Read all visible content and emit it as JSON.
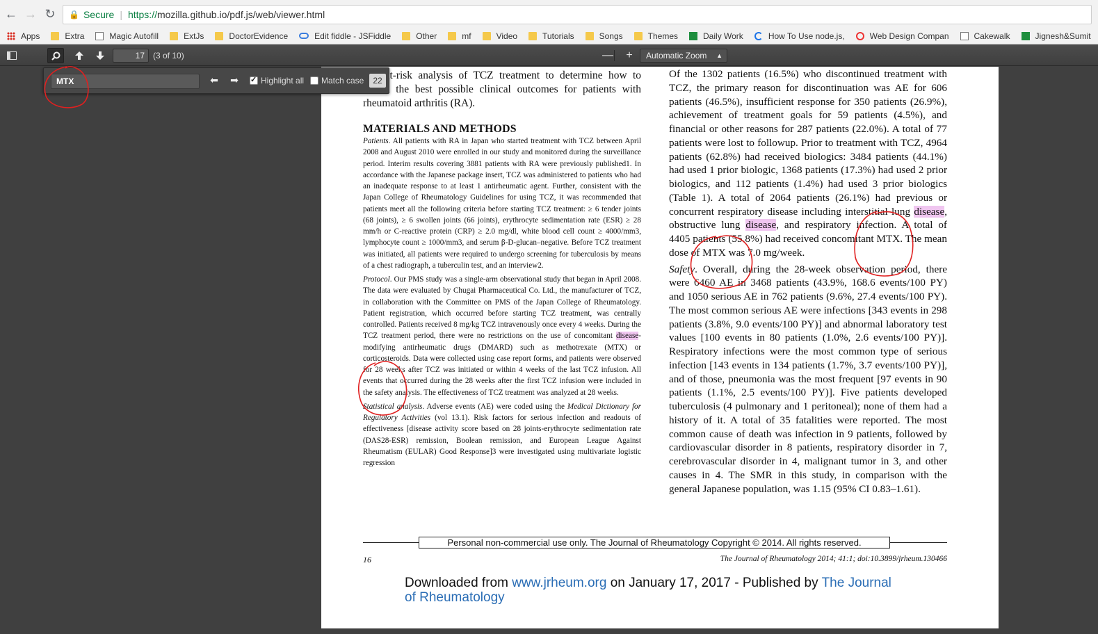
{
  "browser": {
    "secure_label": "Secure",
    "url_scheme": "https://",
    "url_rest": "mozilla.github.io/pdf.js/web/viewer.html",
    "bookmarks": [
      {
        "label": "Apps",
        "icon": "apps-icon"
      },
      {
        "label": "Extra",
        "icon": "folder-icon"
      },
      {
        "label": "Magic Autofill",
        "icon": "page-icon"
      },
      {
        "label": "ExtJs",
        "icon": "folder-icon"
      },
      {
        "label": "DoctorEvidence",
        "icon": "folder-icon"
      },
      {
        "label": "Edit fiddle - JSFiddle",
        "icon": "cloud-icon"
      },
      {
        "label": "Other",
        "icon": "folder-icon"
      },
      {
        "label": "mf",
        "icon": "folder-icon"
      },
      {
        "label": "Video",
        "icon": "folder-icon"
      },
      {
        "label": "Tutorials",
        "icon": "folder-icon"
      },
      {
        "label": "Songs",
        "icon": "folder-icon"
      },
      {
        "label": "Themes",
        "icon": "folder-icon"
      },
      {
        "label": "Daily Work",
        "icon": "sheet-icon"
      },
      {
        "label": "How To Use node.js,",
        "icon": "spinner-icon"
      },
      {
        "label": "Web Design Compan",
        "icon": "ring-icon"
      },
      {
        "label": "Cakewalk",
        "icon": "page-icon"
      },
      {
        "label": "Jignesh&Sumit",
        "icon": "sheet-icon"
      }
    ]
  },
  "toolbar": {
    "page_number": "17",
    "page_count": "(3 of 10)",
    "zoom_out": "—",
    "zoom_in": "+",
    "zoom_label": "Automatic Zoom"
  },
  "findbar": {
    "query": "MTX",
    "highlight_all_label": "Highlight all",
    "match_case_label": "Match case",
    "match_count": "22"
  },
  "document": {
    "intro_1": "benefit-risk analysis of TCZ treatment to determine how to",
    "intro_2": "obtain the best possible clinical outcomes for patients with",
    "intro_3": "rheumatoid arthritis (RA).",
    "heading": "MATERIALS AND METHODS",
    "patients_label": "Patients",
    "patients_text": ". All patients with RA in Japan who started treatment with TCZ between April 2008 and August 2010 were enrolled in our study and monitored during the surveillance period. Interim results covering 3881 patients with RA were previously published1. In accordance with the Japanese package insert, TCZ was administered to patients who had an inadequate response to at least 1 antirheumatic agent. Further, consistent with the Japan College of Rheumatology Guidelines for using TCZ, it was recommended that patients meet all the following criteria before starting TCZ treatment: ≥ 6 tender joints (68 joints), ≥ 6 swollen joints (66 joints), erythrocyte sedimentation rate (ESR) ≥ 28 mm/h or C-reactive protein (CRP) ≥ 2.0 mg/dl, white blood cell count ≥ 4000/mm3, lymphocyte count ≥ 1000/mm3, and serum β-D-glucan–negative. Before TCZ treatment was initiated, all patients were required to undergo screening for tuberculosis by means of a chest radiograph, a tuberculin test, and an interview2.",
    "protocol_label": "Protocol",
    "protocol_text_1": ". Our PMS study was a single-arm observational study that began in April 2008. The data were evaluated by Chugai Pharmaceutical Co. Ltd., the manufacturer of TCZ, in collaboration with the Committee on PMS of the Japan College of Rheumatology. Patient registration, which occurred before starting TCZ treatment, was centrally controlled. Patients received 8 mg/kg TCZ intravenously once every 4 weeks. During the TCZ treatment period, there were no restrictions on the use of concomitant ",
    "protocol_hl": "disease",
    "protocol_text_2": "-modifying antirheumatic drugs (DMARD) such as methotrexate (MTX) or corticosteroids. Data were collected using case report forms, and patients were observed for 28 weeks after TCZ was initiated or within 4 weeks of the last TCZ infusion. All events that occurred during the 28 weeks after the first TCZ infusion were included in the safety analysis. The effectiveness of TCZ treatment was analyzed at 28 weeks.",
    "stat_label": "Statistical analysis",
    "stat_text_1": ". Adverse events (AE) were coded using the ",
    "stat_italic": "Medical Dictionary for Regulatory Activities",
    "stat_text_2": " (vol 13.1). Risk factors for serious infection and readouts of effectiveness [disease activity score based on 28 joints-erythrocyte sedimentation rate (DAS28-ESR) remission, Boolean remission, and European League Against Rheumatism (EULAR) Good Response]3 were investigated using multivariate logistic regression",
    "right_1": "Of the 1302 patients (16.5%) who discontinued treatment with TCZ, the primary reason for discontinuation was AE for 606 patients (46.5%), insufficient response for 350 patients (26.9%), achievement of treatment goals for 59 patients (4.5%), and financial or other reasons for 287 patients (22.0%). A total of 77 patients were lost to followup. Prior to treatment with TCZ, 4964 patients (62.8%) had received biologics: 3484 patients (44.1%) had used 1 prior biologic, 1368 patients (17.3%) had used 2 prior biologics, and 112 patients (1.4%) had used 3 prior biologics (Table 1). A total of 2064 patients (26.1%) had previous or concurrent respiratory disease including interstitial lung ",
    "right_hl_1": "disease",
    "right_2": ", obstructive lung ",
    "right_hl_2": "disease",
    "right_3": ", and respiratory infection. A total of 4405 patients (55.8%) had received concomitant MTX. The mean dose of MTX was 7.0 mg/week.",
    "safety_label": "Safety",
    "safety_text": ". Overall, during the 28-week observation period, there were 6460 AE in 3468 patients (43.9%, 168.6 events/100 PY) and 1050 serious AE in 762 patients (9.6%, 27.4 events/100 PY). The most common serious AE were infections [343 events in 298 patients (3.8%, 9.0 events/100 PY)] and abnormal laboratory test values [100 events in 80 patients (1.0%, 2.6 events/100 PY)]. Respiratory infections were the most common type of serious infection [143 events in 134 patients (1.7%, 3.7 events/100 PY)], and of those, pneumonia was the most frequent [97 events in 90 patients (1.1%, 2.5 events/100 PY)]. Five patients developed tuberculosis (4 pulmonary and 1 peritoneal); none of them had a history of it. A total of 35 fatalities were reported. The most common cause of death was infection in 9 patients, followed by cardiovascular disorder in 8 patients, respiratory disorder in 7, cerebrovascular disorder in 4, malignant tumor in 3, and other causes in 4. The SMR in this study, in comparison with the general Japanese population, was 1.15 (95% CI 0.83–1.61).",
    "copyright": "Personal non-commercial use only. The Journal of Rheumatology Copyright © 2014. All rights reserved.",
    "page_num": "16",
    "journal_ref": "The Journal of Rheumatology 2014; 41:1; doi:10.3899/jrheum.130466",
    "dl_1": "Downloaded from ",
    "dl_link": "www.jrheum.org",
    "dl_2": " on January 17, 2017 - Published by ",
    "dl_publisher": "The Journal of Rheumatology"
  },
  "colors": {
    "annotation": "#e02020",
    "highlight": "#f0c6f0",
    "link": "#2a6db5"
  }
}
